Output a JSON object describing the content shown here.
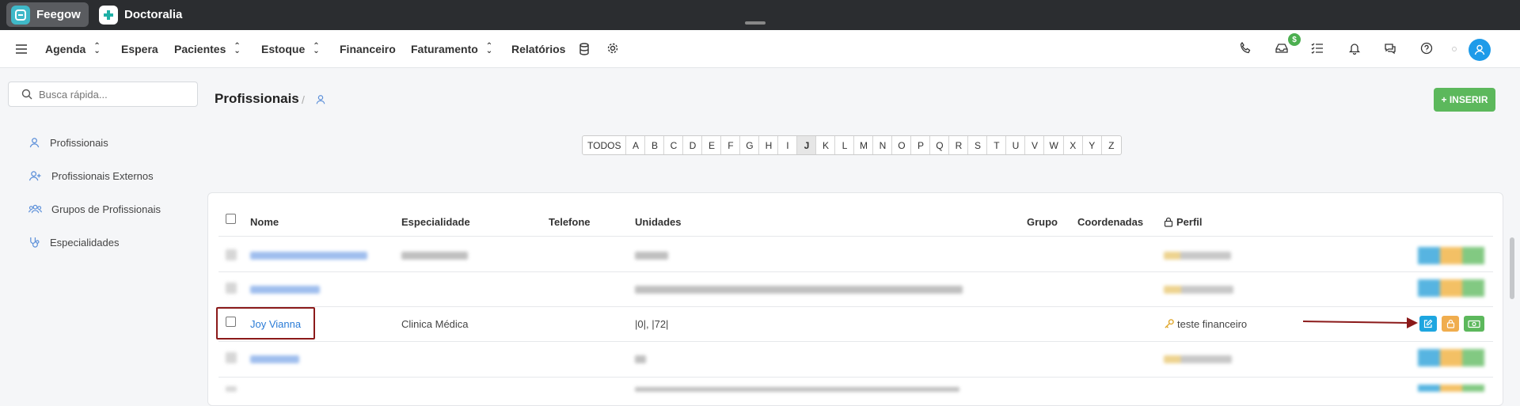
{
  "topbar": {
    "apps": [
      {
        "label": "Feegow",
        "icon": "feegow-logo-icon",
        "active": true
      },
      {
        "label": "Doctoralia",
        "icon": "doctoralia-logo-icon",
        "active": false
      }
    ]
  },
  "nav": {
    "items": [
      {
        "label": "Agenda",
        "dropdown": true
      },
      {
        "label": "Espera",
        "dropdown": false
      },
      {
        "label": "Pacientes",
        "dropdown": true
      },
      {
        "label": "Estoque",
        "dropdown": true
      },
      {
        "label": "Financeiro",
        "dropdown": false
      },
      {
        "label": "Faturamento",
        "dropdown": true
      },
      {
        "label": "Relatórios",
        "dropdown": false
      }
    ],
    "inbox_badge": "$"
  },
  "sidebar": {
    "search_placeholder": "Busca rápida...",
    "items": [
      {
        "label": "Profissionais",
        "icon": "user-icon"
      },
      {
        "label": "Profissionais Externos",
        "icon": "user-plus-icon"
      },
      {
        "label": "Grupos de Profissionais",
        "icon": "users-icon"
      },
      {
        "label": "Especialidades",
        "icon": "stethoscope-icon"
      }
    ]
  },
  "main": {
    "title": "Profissionais",
    "insert_label": "+ INSERIR",
    "alphabet": [
      "TODOS",
      "A",
      "B",
      "C",
      "D",
      "E",
      "F",
      "G",
      "H",
      "I",
      "J",
      "K",
      "L",
      "M",
      "N",
      "O",
      "P",
      "Q",
      "R",
      "S",
      "T",
      "U",
      "V",
      "W",
      "X",
      "Y",
      "Z"
    ],
    "alphabet_selected": "J",
    "table": {
      "headers": {
        "nome": "Nome",
        "especialidade": "Especialidade",
        "telefone": "Telefone",
        "unidades": "Unidades",
        "grupo": "Grupo",
        "coordenadas": "Coordenadas",
        "perfil": "Perfil"
      },
      "highlighted_row": {
        "nome": "Joy Vianna",
        "especialidade": "Clinica Médica",
        "telefone": "",
        "unidades": "|0|, |72|",
        "perfil": "teste financeiro"
      }
    }
  },
  "colors": {
    "accent_blue": "#1e9be9",
    "success_green": "#5cb85c",
    "warning_orange": "#f0ad4e",
    "highlight_red": "#8b1a1a"
  }
}
